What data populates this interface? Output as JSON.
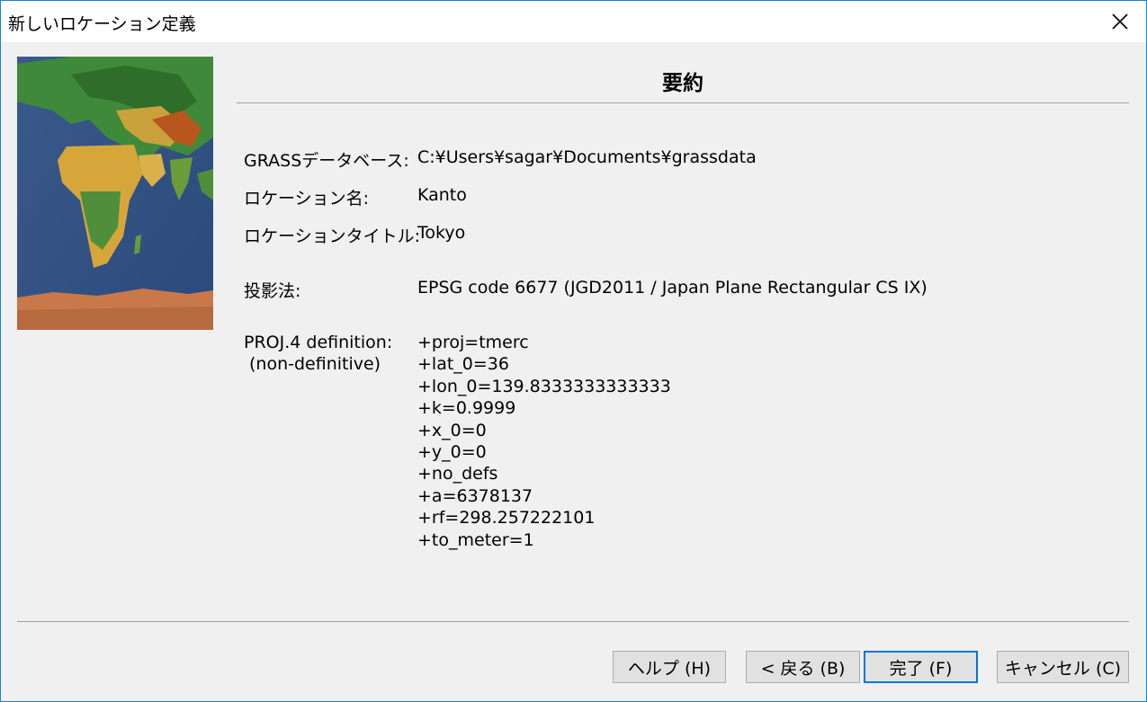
{
  "window": {
    "title": "新しいロケーション定義",
    "close_icon": "close-icon"
  },
  "page": {
    "heading": "要約"
  },
  "summary": {
    "database_label": "GRASSデータベース:",
    "database_value": "C:¥Users¥sagar¥Documents¥grassdata",
    "location_label": "ロケーション名:",
    "location_value": "Kanto",
    "title_label": "ロケーションタイトル:",
    "title_value": "Tokyo",
    "projection_label": "投影法:",
    "projection_value": "EPSG code 6677 (JGD2011 / Japan Plane Rectangular CS IX)",
    "proj4_label_line1": "PROJ.4 definition:",
    "proj4_label_line2": "(non-definitive)",
    "proj4_lines": [
      "+proj=tmerc",
      "+lat_0=36",
      "+lon_0=139.8333333333333",
      "+k=0.9999",
      "+x_0=0",
      "+y_0=0",
      "+no_defs",
      "+a=6378137",
      "+rf=298.257222101",
      "+to_meter=1"
    ]
  },
  "buttons": {
    "help": "ヘルプ (H)",
    "back": "< 戻る (B)",
    "finish": "完了 (F)",
    "cancel": "キャンセル (C)"
  }
}
